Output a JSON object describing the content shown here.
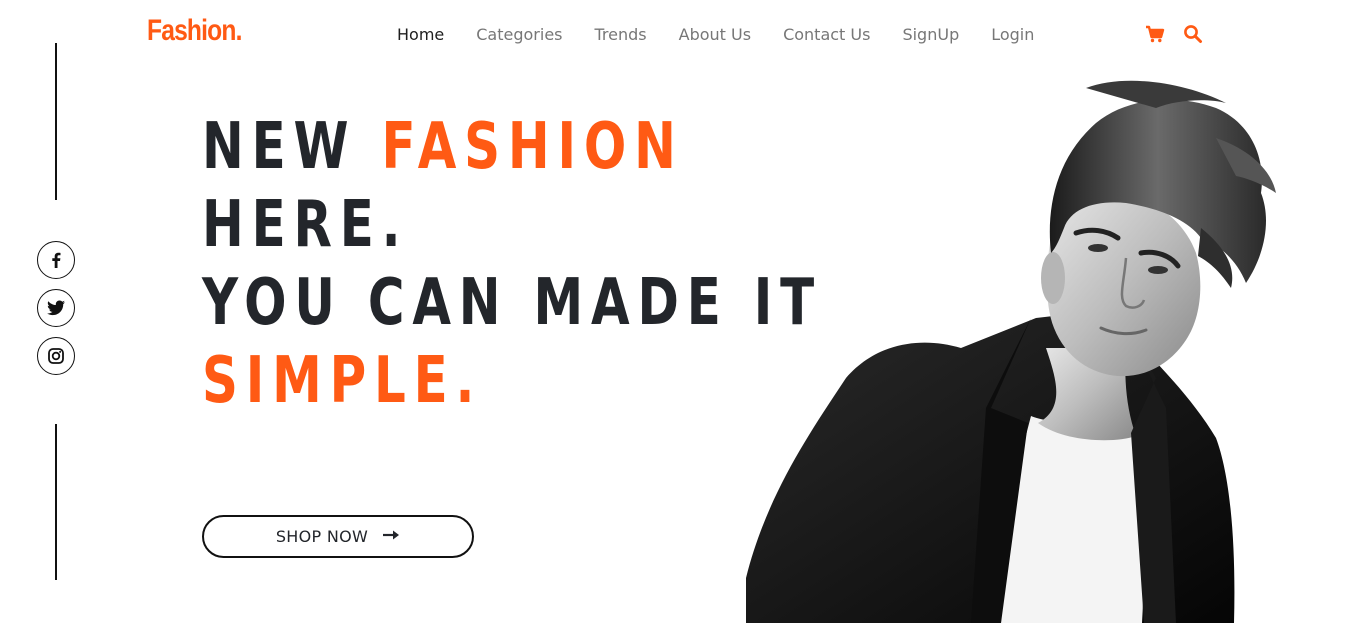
{
  "brand": {
    "logo_text": "Fashion.",
    "accent_color": "#ff5a14"
  },
  "nav": {
    "items": [
      {
        "label": "Home",
        "active": true
      },
      {
        "label": "Categories",
        "active": false
      },
      {
        "label": "Trends",
        "active": false
      },
      {
        "label": "About Us",
        "active": false
      },
      {
        "label": "Contact Us",
        "active": false
      },
      {
        "label": "SignUp",
        "active": false
      },
      {
        "label": "Login",
        "active": false
      }
    ],
    "icons": [
      "cart-icon",
      "search-icon"
    ]
  },
  "social": {
    "icons": [
      "facebook-icon",
      "twitter-icon",
      "instagram-icon"
    ]
  },
  "hero": {
    "line1_a": "NEW",
    "line1_b": "FASHION",
    "line2": "HERE.",
    "line3": "YOU CAN MADE IT",
    "line4": "SIMPLE.",
    "button_label": "SHOP NOW",
    "button_icon": "arrow-right-icon",
    "image": "man-in-black-jacket-photo"
  }
}
